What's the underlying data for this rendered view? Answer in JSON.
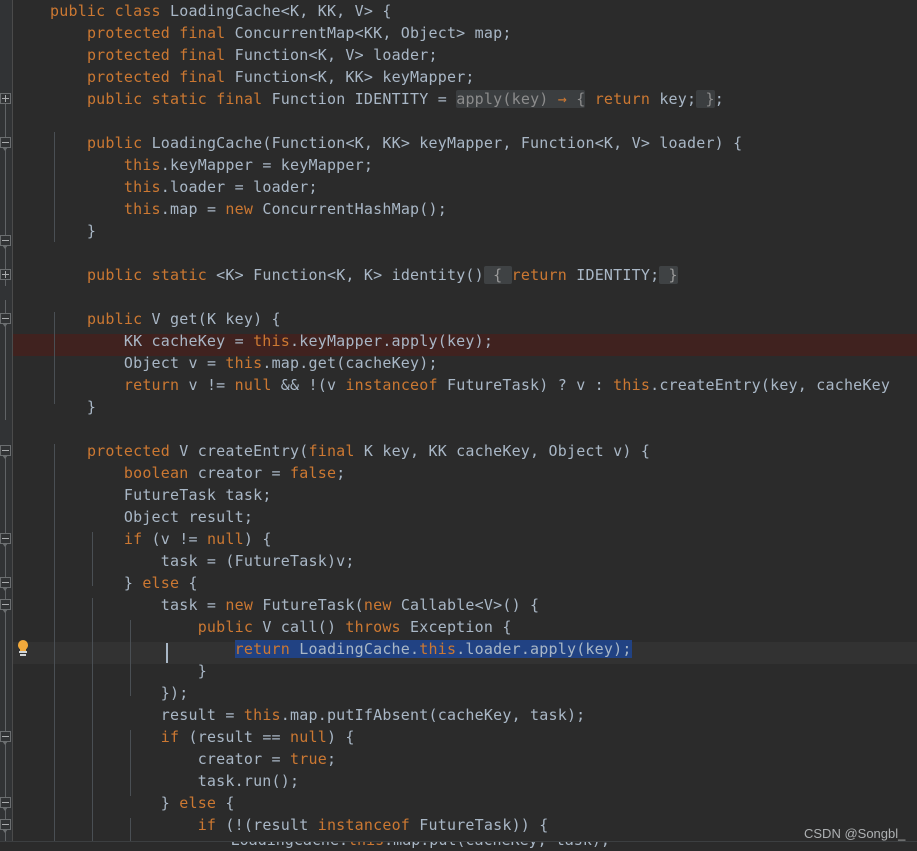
{
  "app": {
    "kind": "code-editor",
    "theme": "darcula",
    "background": "#2b2b2b",
    "gutter_background": "#313335",
    "text_color": "#a9b7c6",
    "keyword_color": "#cc7832",
    "selection_color": "#214283",
    "breakpoint_line_color": "#40221f",
    "fold_chip_color": "#3f4244",
    "indent_guide_color": "#4a4f54",
    "bulb_color": "#f2a93b"
  },
  "watermark": {
    "text": "CSDN @Songbl_",
    "color": "#b9bcbe"
  },
  "gutter": {
    "icons": [
      {
        "name": "fold-expand-plus",
        "line": 4
      },
      {
        "name": "fold-collapse-minus",
        "line": 6
      },
      {
        "name": "fold-collapse-minus",
        "line": 11
      },
      {
        "name": "fold-expand-plus",
        "line": 13
      },
      {
        "name": "fold-collapse-minus",
        "line": 15
      },
      {
        "name": "fold-collapse-minus",
        "line": 21
      },
      {
        "name": "fold-collapse-minus",
        "line": 24
      },
      {
        "name": "fold-collapse-minus",
        "line": 26
      },
      {
        "name": "fold-collapse-minus",
        "line": 31
      },
      {
        "name": "fold-collapse-minus",
        "line": 34
      },
      {
        "name": "fold-collapse-minus",
        "line": 37
      },
      {
        "name": "intention-lightbulb",
        "line": 29
      }
    ]
  },
  "editor": {
    "file_language": "java",
    "selected_text": "return LoadingCache.this.loader.apply(key);",
    "folded_regions": [
      "{ return key; }",
      "{ return IDENTITY; }"
    ],
    "lines": [
      {
        "n": 1,
        "text": "public class LoadingCache<K, KK, V> {"
      },
      {
        "n": 2,
        "text": "    protected final ConcurrentMap<KK, Object> map;"
      },
      {
        "n": 3,
        "text": "    protected final Function<K, V> loader;"
      },
      {
        "n": 4,
        "text": "    protected final Function<K, KK> keyMapper;"
      },
      {
        "n": 5,
        "text": "    public static final Function IDENTITY = apply(key) → { return key; };"
      },
      {
        "n": 6,
        "text": ""
      },
      {
        "n": 7,
        "text": "    public LoadingCache(Function<K, KK> keyMapper, Function<K, V> loader) {"
      },
      {
        "n": 8,
        "text": "        this.keyMapper = keyMapper;"
      },
      {
        "n": 9,
        "text": "        this.loader = loader;"
      },
      {
        "n": 10,
        "text": "        this.map = new ConcurrentHashMap();"
      },
      {
        "n": 11,
        "text": "    }"
      },
      {
        "n": 12,
        "text": ""
      },
      {
        "n": 13,
        "text": "    public static <K> Function<K, K> identity() { return IDENTITY; }"
      },
      {
        "n": 14,
        "text": ""
      },
      {
        "n": 15,
        "text": "    public V get(K key) {"
      },
      {
        "n": 16,
        "text": "        KK cacheKey = this.keyMapper.apply(key);"
      },
      {
        "n": 17,
        "text": "        Object v = this.map.get(cacheKey);"
      },
      {
        "n": 18,
        "text": "        return v != null && !(v instanceof FutureTask) ? v : this.createEntry(key, cacheKey"
      },
      {
        "n": 19,
        "text": "    }"
      },
      {
        "n": 20,
        "text": ""
      },
      {
        "n": 21,
        "text": "    protected V createEntry(final K key, KK cacheKey, Object v) {"
      },
      {
        "n": 22,
        "text": "        boolean creator = false;"
      },
      {
        "n": 23,
        "text": "        FutureTask task;"
      },
      {
        "n": 24,
        "text": "        Object result;"
      },
      {
        "n": 25,
        "text": "        if (v != null) {"
      },
      {
        "n": 26,
        "text": "            task = (FutureTask)v;"
      },
      {
        "n": 27,
        "text": "        } else {"
      },
      {
        "n": 28,
        "text": "            task = new FutureTask(new Callable<V>() {"
      },
      {
        "n": 29,
        "text": "                public V call() throws Exception {"
      },
      {
        "n": 30,
        "text": "                    return LoadingCache.this.loader.apply(key);"
      },
      {
        "n": 31,
        "text": "                }"
      },
      {
        "n": 32,
        "text": "            });"
      },
      {
        "n": 33,
        "text": "            result = this.map.putIfAbsent(cacheKey, task);"
      },
      {
        "n": 34,
        "text": "            if (result == null) {"
      },
      {
        "n": 35,
        "text": "                creator = true;"
      },
      {
        "n": 36,
        "text": "                task.run();"
      },
      {
        "n": 37,
        "text": "            } else {"
      },
      {
        "n": 38,
        "text": "                if (!(result instanceof FutureTask)) {"
      },
      {
        "n": 39,
        "text": "                    LoadingCache.this.map.put(cacheKey, task);"
      }
    ]
  }
}
